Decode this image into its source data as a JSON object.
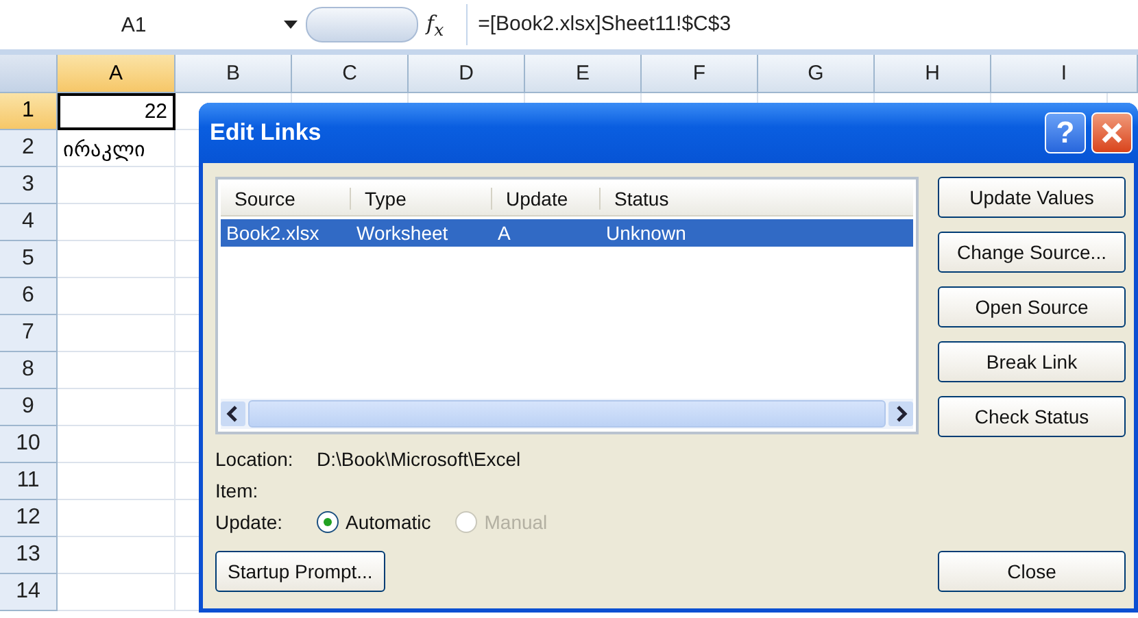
{
  "formula_bar": {
    "name_box": "A1",
    "function_label": "f$_{x}$",
    "formula": "=[Book2.xlsx]Sheet11!$C$3"
  },
  "columns": [
    {
      "label": "A",
      "selected": true
    },
    {
      "label": "B",
      "selected": false
    },
    {
      "label": "C",
      "selected": false
    },
    {
      "label": "D",
      "selected": false
    },
    {
      "label": "E",
      "selected": false
    },
    {
      "label": "F",
      "selected": false
    },
    {
      "label": "G",
      "selected": false
    },
    {
      "label": "H",
      "selected": false
    },
    {
      "label": "I",
      "selected": false
    }
  ],
  "rows": [
    {
      "label": "1",
      "selected": true,
      "cell_a": "22"
    },
    {
      "label": "2",
      "selected": false,
      "cell_a": "ირაკლი"
    },
    {
      "label": "3",
      "selected": false
    },
    {
      "label": "4",
      "selected": false
    },
    {
      "label": "5",
      "selected": false
    },
    {
      "label": "6",
      "selected": false
    },
    {
      "label": "7",
      "selected": false
    },
    {
      "label": "8",
      "selected": false
    },
    {
      "label": "9",
      "selected": false
    },
    {
      "label": "10",
      "selected": false
    },
    {
      "label": "11",
      "selected": false
    },
    {
      "label": "12",
      "selected": false
    },
    {
      "label": "13",
      "selected": false
    },
    {
      "label": "14",
      "selected": false
    }
  ],
  "dialog": {
    "title": "Edit Links",
    "help_label": "?",
    "list": {
      "columns": [
        "Source",
        "Type",
        "Update",
        "Status"
      ],
      "rows": [
        {
          "source": "Book2.xlsx",
          "type": "Worksheet",
          "update": "A",
          "status": "Unknown",
          "selected": true
        }
      ]
    },
    "location_label": "Location:",
    "location_value": "D:\\Book\\Microsoft\\Excel",
    "item_label": "Item:",
    "update_label": "Update:",
    "update_options": [
      {
        "label": "Automatic",
        "selected": true,
        "disabled": false
      },
      {
        "label": "Manual",
        "selected": false,
        "disabled": true
      }
    ],
    "side_buttons": [
      "Update Values",
      "Change Source...",
      "Open Source",
      "Break Link",
      "Check Status"
    ],
    "startup_button": "Startup Prompt...",
    "close_button": "Close"
  }
}
